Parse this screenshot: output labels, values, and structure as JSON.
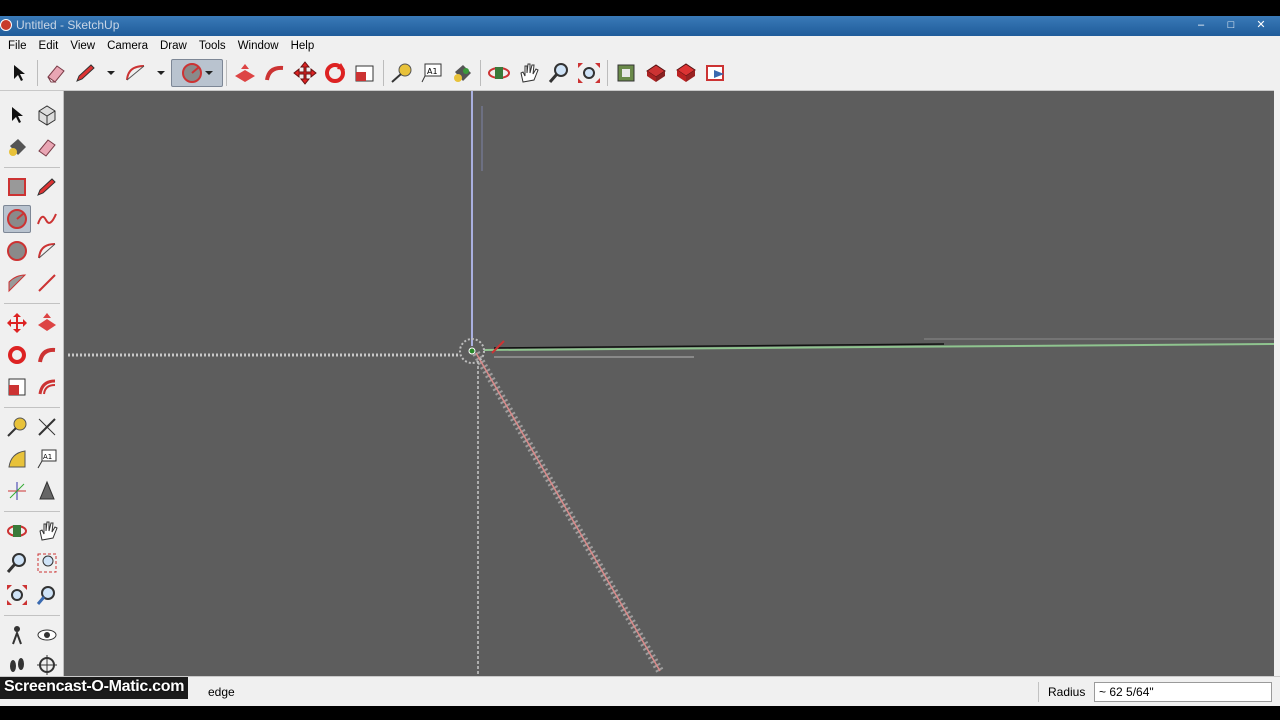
{
  "window": {
    "title": "Untitled - SketchUp",
    "controls": {
      "minimize": "–",
      "maximize": "□",
      "close": "✕"
    }
  },
  "menu": [
    "File",
    "Edit",
    "View",
    "Camera",
    "Draw",
    "Tools",
    "Window",
    "Help"
  ],
  "top_toolbar": [
    {
      "name": "select-tool",
      "icon": "arrow-cursor-icon"
    },
    {
      "name": "eraser-tool",
      "icon": "eraser-icon"
    },
    {
      "name": "line-tool",
      "icon": "pencil-icon"
    },
    {
      "name": "line-tool-dropdown",
      "icon": "dropdown-arrow-icon"
    },
    {
      "name": "arc-tool",
      "icon": "arc-icon"
    },
    {
      "name": "arc-tool-dropdown",
      "icon": "dropdown-arrow-icon"
    },
    {
      "name": "circle-tool",
      "icon": "circle-icon",
      "active": true
    },
    {
      "name": "push-pull-tool",
      "icon": "push-pull-icon"
    },
    {
      "name": "follow-me-tool",
      "icon": "follow-me-icon"
    },
    {
      "name": "move-tool",
      "icon": "move-icon"
    },
    {
      "name": "rotate-tool",
      "icon": "rotate-icon"
    },
    {
      "name": "scale-tool",
      "icon": "scale-icon"
    },
    {
      "name": "tape-measure-tool",
      "icon": "tape-measure-icon"
    },
    {
      "name": "text-tool",
      "icon": "text-icon"
    },
    {
      "name": "paint-bucket-tool",
      "icon": "paint-bucket-icon"
    },
    {
      "name": "orbit-tool",
      "icon": "orbit-icon"
    },
    {
      "name": "pan-tool",
      "icon": "hand-icon"
    },
    {
      "name": "zoom-tool",
      "icon": "magnifier-icon"
    },
    {
      "name": "zoom-extents-tool",
      "icon": "zoom-extents-icon"
    },
    {
      "name": "3d-warehouse",
      "icon": "warehouse-icon"
    },
    {
      "name": "share-model",
      "icon": "share-model-icon"
    },
    {
      "name": "get-models",
      "icon": "get-models-icon"
    },
    {
      "name": "send-to-layout",
      "icon": "layout-icon"
    }
  ],
  "status": {
    "message": "edge",
    "vcb_label": "Radius",
    "vcb_value": "~ 62 5/64\""
  },
  "watermark": "Screencast-O-Matic.com",
  "colors": {
    "viewport": "#5d5d5d",
    "red_axis": "#d98080",
    "green_axis": "#8fc48f",
    "blue_axis": "#9aa3d8",
    "title_bar": "#2a6aa8"
  }
}
